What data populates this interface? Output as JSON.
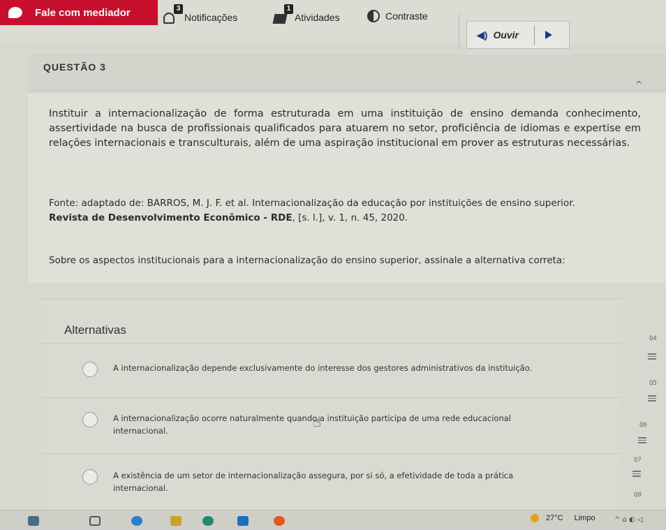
{
  "topbar": {
    "chat_label": "Fale com mediador",
    "notifications_label": "Notificações",
    "notifications_count": "3",
    "activities_label": "Atividades",
    "activities_count": "1",
    "contrast_label": "Contraste",
    "listen_label": "Ouvir"
  },
  "question": {
    "title": "QUESTÃO 3",
    "stem": "Instituir a internacionalização de forma estruturada em uma instituição de ensino demanda conhecimento, assertividade na busca de profissionais qualificados para atuarem no setor, proficiência de idiomas e expertise em relações internacionais e transculturais, além de uma aspiração institucional em prover as estruturas necessárias.",
    "source_line1": "Fonte: adaptado de: BARROS, M. J. F. et al. Internacionalização da educação por instituições de ensino superior.",
    "source_journal": "Revista de Desenvolvimento Econômico - RDE",
    "source_rest": ", [s. l.], v. 1, n. 45, 2020.",
    "prompt": "Sobre os aspectos institucionais para a internacionalização do ensino superior, assinale a alternativa correta:"
  },
  "alternatives": {
    "title": "Alternativas",
    "items": [
      {
        "text": "A internacionalização depende exclusivamente do interesse dos gestores administrativos da instituição."
      },
      {
        "text": "A internacionalização ocorre naturalmente quando a instituição participa de uma rede educacional internacional."
      },
      {
        "text": "A existência de um setor de internacionalização assegura, por si só, a efetividade de toda a prática internacional."
      }
    ]
  },
  "right_nav": {
    "items": [
      "Q4",
      "Q5",
      "Q6",
      "Q7",
      "Q8"
    ]
  },
  "taskbar": {
    "temperature": "27°C",
    "weather": "Limpo"
  },
  "colors": {
    "accent": "#c8102e",
    "link_blue": "#1a3a8a"
  }
}
